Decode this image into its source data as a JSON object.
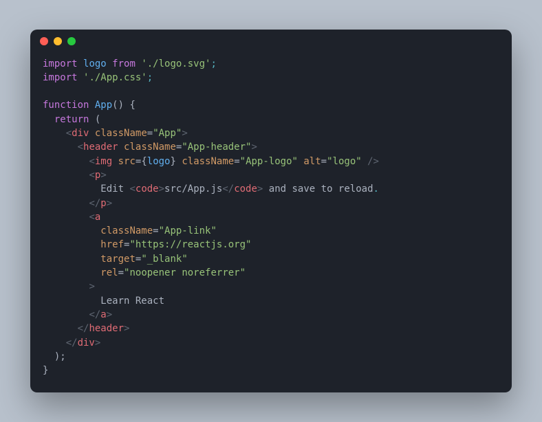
{
  "window": {
    "traffic_lights": [
      "red",
      "yellow",
      "green"
    ]
  },
  "colors": {
    "bg_page": "#b8c1cc",
    "bg_window": "#1e222a",
    "red": "#ff5f56",
    "yellow": "#ffbd2e",
    "green": "#27c93f",
    "keyword": "#c678dd",
    "function": "#61afef",
    "string": "#98c379",
    "tag": "#e06c75",
    "attr": "#d19a66",
    "punct": "#abb2bf",
    "angle": "#5f6672",
    "accent": "#56b6c2"
  },
  "code": {
    "language": "jsx",
    "tokens": [
      [
        [
          "kw",
          "import"
        ],
        [
          "pun",
          " "
        ],
        [
          "fn",
          "logo"
        ],
        [
          "pun",
          " "
        ],
        [
          "kw",
          "from"
        ],
        [
          "pun",
          " "
        ],
        [
          "str",
          "'./logo.svg'"
        ],
        [
          "sc",
          ";"
        ]
      ],
      [
        [
          "kw",
          "import"
        ],
        [
          "pun",
          " "
        ],
        [
          "str",
          "'./App.css'"
        ],
        [
          "sc",
          ";"
        ]
      ],
      [],
      [
        [
          "kw",
          "function"
        ],
        [
          "pun",
          " "
        ],
        [
          "fn",
          "App"
        ],
        [
          "pun",
          "() {"
        ]
      ],
      [
        [
          "pun",
          "  "
        ],
        [
          "kw",
          "return"
        ],
        [
          "pun",
          " ("
        ]
      ],
      [
        [
          "pun",
          "    "
        ],
        [
          "ang",
          "<"
        ],
        [
          "tag",
          "div"
        ],
        [
          "pun",
          " "
        ],
        [
          "attr",
          "className"
        ],
        [
          "pun",
          "="
        ],
        [
          "str",
          "\"App\""
        ],
        [
          "ang",
          ">"
        ]
      ],
      [
        [
          "pun",
          "      "
        ],
        [
          "ang",
          "<"
        ],
        [
          "tag",
          "header"
        ],
        [
          "pun",
          " "
        ],
        [
          "attr",
          "className"
        ],
        [
          "pun",
          "="
        ],
        [
          "str",
          "\"App-header\""
        ],
        [
          "ang",
          ">"
        ]
      ],
      [
        [
          "pun",
          "        "
        ],
        [
          "ang",
          "<"
        ],
        [
          "tag",
          "img"
        ],
        [
          "pun",
          " "
        ],
        [
          "attr",
          "src"
        ],
        [
          "pun",
          "={"
        ],
        [
          "fn",
          "logo"
        ],
        [
          "pun",
          "} "
        ],
        [
          "attr",
          "className"
        ],
        [
          "pun",
          "="
        ],
        [
          "str",
          "\"App-logo\""
        ],
        [
          "pun",
          " "
        ],
        [
          "attr",
          "alt"
        ],
        [
          "pun",
          "="
        ],
        [
          "str",
          "\"logo\""
        ],
        [
          "pun",
          " "
        ],
        [
          "ang",
          "/>"
        ]
      ],
      [
        [
          "pun",
          "        "
        ],
        [
          "ang",
          "<"
        ],
        [
          "tag",
          "p"
        ],
        [
          "ang",
          ">"
        ]
      ],
      [
        [
          "pun",
          "          "
        ],
        [
          "txt",
          "Edit "
        ],
        [
          "ang",
          "<"
        ],
        [
          "tag",
          "code"
        ],
        [
          "ang",
          ">"
        ],
        [
          "txt",
          "src/App.js"
        ],
        [
          "ang",
          "</"
        ],
        [
          "tag",
          "code"
        ],
        [
          "ang",
          ">"
        ],
        [
          "txt",
          " and save to reload"
        ],
        [
          "sc",
          "."
        ]
      ],
      [
        [
          "pun",
          "        "
        ],
        [
          "ang",
          "</"
        ],
        [
          "tag",
          "p"
        ],
        [
          "ang",
          ">"
        ]
      ],
      [
        [
          "pun",
          "        "
        ],
        [
          "ang",
          "<"
        ],
        [
          "tag",
          "a"
        ]
      ],
      [
        [
          "pun",
          "          "
        ],
        [
          "attr",
          "className"
        ],
        [
          "pun",
          "="
        ],
        [
          "str",
          "\"App-link\""
        ]
      ],
      [
        [
          "pun",
          "          "
        ],
        [
          "attr",
          "href"
        ],
        [
          "pun",
          "="
        ],
        [
          "str",
          "\"https://reactjs.org\""
        ]
      ],
      [
        [
          "pun",
          "          "
        ],
        [
          "attr",
          "target"
        ],
        [
          "pun",
          "="
        ],
        [
          "str",
          "\"_blank\""
        ]
      ],
      [
        [
          "pun",
          "          "
        ],
        [
          "attr",
          "rel"
        ],
        [
          "pun",
          "="
        ],
        [
          "str",
          "\"noopener noreferrer\""
        ]
      ],
      [
        [
          "pun",
          "        "
        ],
        [
          "ang",
          ">"
        ]
      ],
      [
        [
          "pun",
          "          "
        ],
        [
          "txt",
          "Learn React"
        ]
      ],
      [
        [
          "pun",
          "        "
        ],
        [
          "ang",
          "</"
        ],
        [
          "tag",
          "a"
        ],
        [
          "ang",
          ">"
        ]
      ],
      [
        [
          "pun",
          "      "
        ],
        [
          "ang",
          "</"
        ],
        [
          "tag",
          "header"
        ],
        [
          "ang",
          ">"
        ]
      ],
      [
        [
          "pun",
          "    "
        ],
        [
          "ang",
          "</"
        ],
        [
          "tag",
          "div"
        ],
        [
          "ang",
          ">"
        ]
      ],
      [
        [
          "pun",
          "  );"
        ]
      ],
      [
        [
          "pun",
          "}"
        ]
      ]
    ]
  }
}
